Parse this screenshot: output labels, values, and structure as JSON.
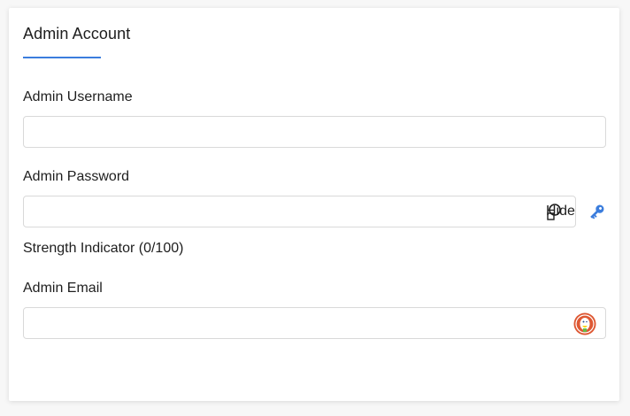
{
  "section": {
    "title": "Admin Account"
  },
  "fields": {
    "username": {
      "label": "Admin Username",
      "value": "",
      "placeholder": ""
    },
    "password": {
      "label": "Admin Password",
      "value": "",
      "placeholder": "",
      "toggle_label": "Hide"
    },
    "strength": {
      "label": "Strength Indicator (0/100)"
    },
    "email": {
      "label": "Admin Email",
      "value": "",
      "placeholder": ""
    }
  },
  "icons": {
    "password_manager": "key-icon",
    "email_protection": "duckduckgo-icon"
  },
  "colors": {
    "accent": "#3b7ddd",
    "border": "#d9d9d9",
    "ddg_orange": "#de5833"
  }
}
